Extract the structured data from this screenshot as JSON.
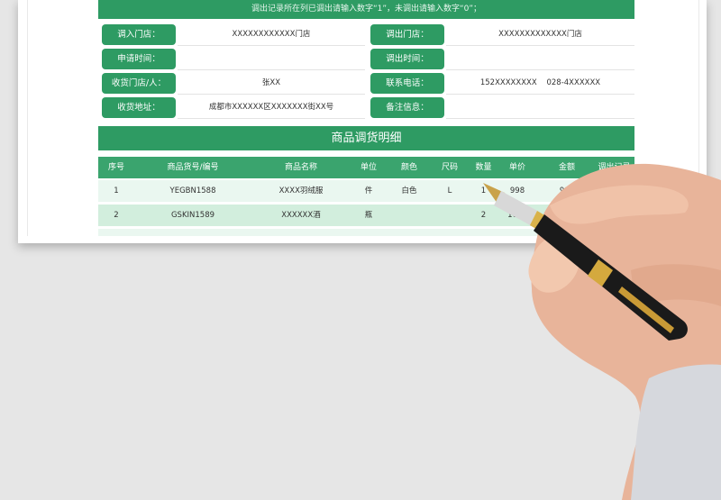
{
  "notice": "调出记录所在列已调出请输入数字“1”，未调出请输入数字“0”；",
  "info": {
    "in_store_label": "调入门店：",
    "in_store_value": "XXXXXXXXXXXX门店",
    "out_store_label": "调出门店：",
    "out_store_value": "XXXXXXXXXXXXX门店",
    "apply_time_label": "申请时间：",
    "apply_time_value": "",
    "out_time_label": "调出时间：",
    "out_time_value": "",
    "receiver_label": "收货门店/人：",
    "receiver_value": "张XX",
    "phone_label": "联系电话：",
    "phone_value": "152XXXXXXXX    028-4XXXXXX",
    "address_label": "收货地址：",
    "address_value": "成都市XXXXXX区XXXXXXX街XX号",
    "remark_label": "备注信息：",
    "remark_value": ""
  },
  "section_title": "商品调货明细",
  "table": {
    "headers": [
      "序号",
      "商品货号/编号",
      "商品名称",
      "单位",
      "颜色",
      "尺码",
      "数量",
      "单价",
      "金额",
      "调出记录"
    ],
    "rows": [
      [
        "1",
        "YEGBN1588",
        "XXXX羽绒服",
        "件",
        "白色",
        "L",
        "1",
        "998",
        "998",
        ""
      ],
      [
        "2",
        "GSKIN1589",
        "XXXXXX酒",
        "瓶",
        "",
        "",
        "2",
        "1088",
        "",
        ""
      ]
    ]
  },
  "colors": {
    "accent": "#2e9b63",
    "row_light": "#eaf7f0",
    "row_alt": "#d2eedd"
  }
}
